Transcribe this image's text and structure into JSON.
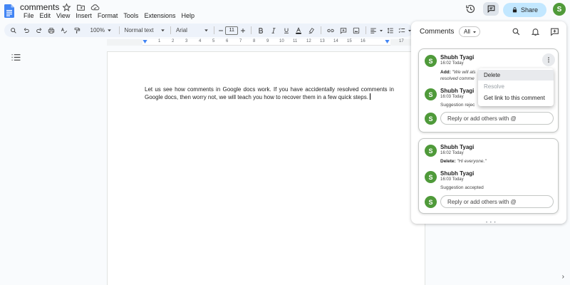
{
  "document": {
    "title": "comments",
    "body": "Let us see how comments in Google docs work. If you have accidentally resolved comments in Google docs, then worry not, we will teach you how to recover them in a few quick steps."
  },
  "menu": [
    "File",
    "Edit",
    "View",
    "Insert",
    "Format",
    "Tools",
    "Extensions",
    "Help"
  ],
  "header": {
    "share_label": "Share",
    "avatar_letter": "S"
  },
  "toolbar": {
    "zoom": "100%",
    "style": "Normal text",
    "font": "Arial",
    "font_size": "11"
  },
  "ruler": {
    "ticks": [
      "1",
      "2",
      "3",
      "4",
      "5",
      "6",
      "7",
      "8",
      "9",
      "10",
      "11",
      "12",
      "13",
      "14",
      "15",
      "16",
      "17"
    ]
  },
  "comments_panel": {
    "title": "Comments",
    "filter": "All",
    "threads": [
      {
        "entries": [
          {
            "author": "Shubh Tyagi",
            "time": "16:02 Today",
            "action": "Add:",
            "quote_line1": "\"We will als",
            "quote_line2": "resolved comme"
          },
          {
            "author": "Shubh Tyagi",
            "time": "16:03 Today",
            "status": "Suggestion rejec"
          }
        ],
        "reply_placeholder": "Reply or add others with @"
      },
      {
        "entries": [
          {
            "author": "Shubh Tyagi",
            "time": "16:02 Today",
            "action": "Delete:",
            "quote": "\"Hi everyone.\""
          },
          {
            "author": "Shubh Tyagi",
            "time": "16:03 Today",
            "status": "Suggestion accepted"
          }
        ],
        "reply_placeholder": "Reply or add others with @"
      }
    ]
  },
  "context_menu": {
    "items": [
      "Delete",
      "Resolve",
      "Get link to this comment"
    ]
  },
  "colors": {
    "avatar": "#4f9a3a",
    "share_bg": "#c2e7ff",
    "toolbar_bg": "#edf2fa",
    "doc_blue": "#4285f4"
  }
}
